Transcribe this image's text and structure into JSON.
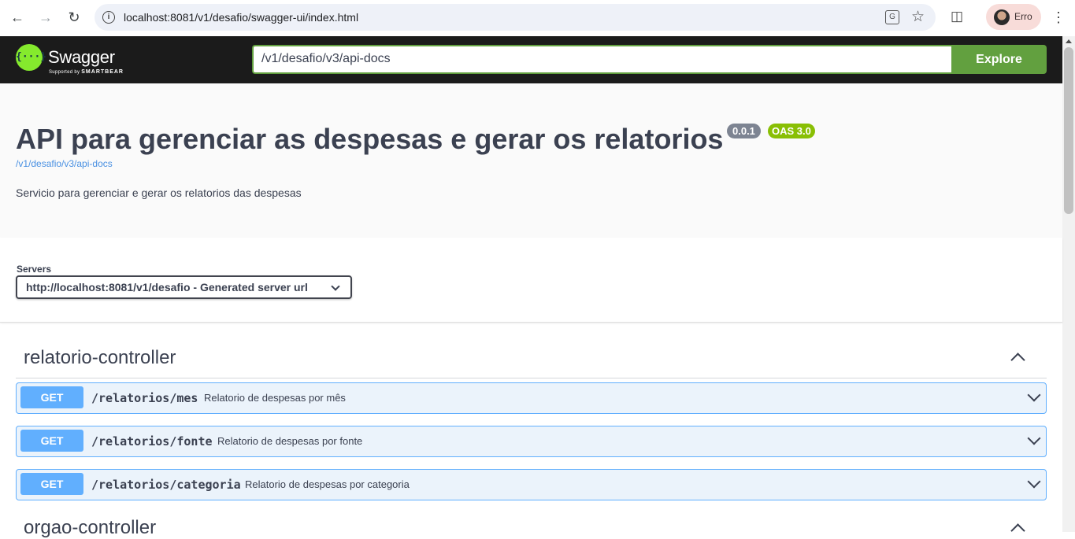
{
  "browser": {
    "url": "localhost:8081/v1/desafio/swagger-ui/index.html",
    "profile_label": "Erro",
    "icons": [
      "back-arrow-icon",
      "forward-arrow-icon",
      "reload-icon",
      "site-info-icon",
      "translate-icon",
      "bookmark-star-icon",
      "extensions-icon",
      "avatar",
      "menu-kebab-icon"
    ]
  },
  "topbar": {
    "logo_text": "Swagger",
    "logo_symbol": "{···}",
    "logo_sub_prefix": "Supported by",
    "logo_sub_brand": "SMARTBEAR",
    "url_value": "/v1/desafio/v3/api-docs",
    "explore_label": "Explore",
    "accent_color": "#62a03f"
  },
  "info": {
    "title": "API para gerenciar as despesas e gerar os relatorios",
    "version_badge": "0.0.1",
    "oas_badge": "OAS 3.0",
    "docs_link": "/v1/desafio/v3/api-docs",
    "description": "Servicio para gerenciar e gerar os relatorios das despesas"
  },
  "servers": {
    "label": "Servers",
    "selected": "http://localhost:8081/v1/desafio - Generated server url"
  },
  "tags": [
    {
      "name": "relatorio-controller",
      "expanded": true,
      "operations": [
        {
          "method": "GET",
          "path": "/relatorios/mes",
          "summary": "Relatorio de despesas por mês"
        },
        {
          "method": "GET",
          "path": "/relatorios/fonte",
          "summary": "Relatorio de despesas por fonte"
        },
        {
          "method": "GET",
          "path": "/relatorios/categoria",
          "summary": "Relatorio de despesas por categoria"
        }
      ]
    },
    {
      "name": "orgao-controller",
      "expanded": true
    }
  ]
}
